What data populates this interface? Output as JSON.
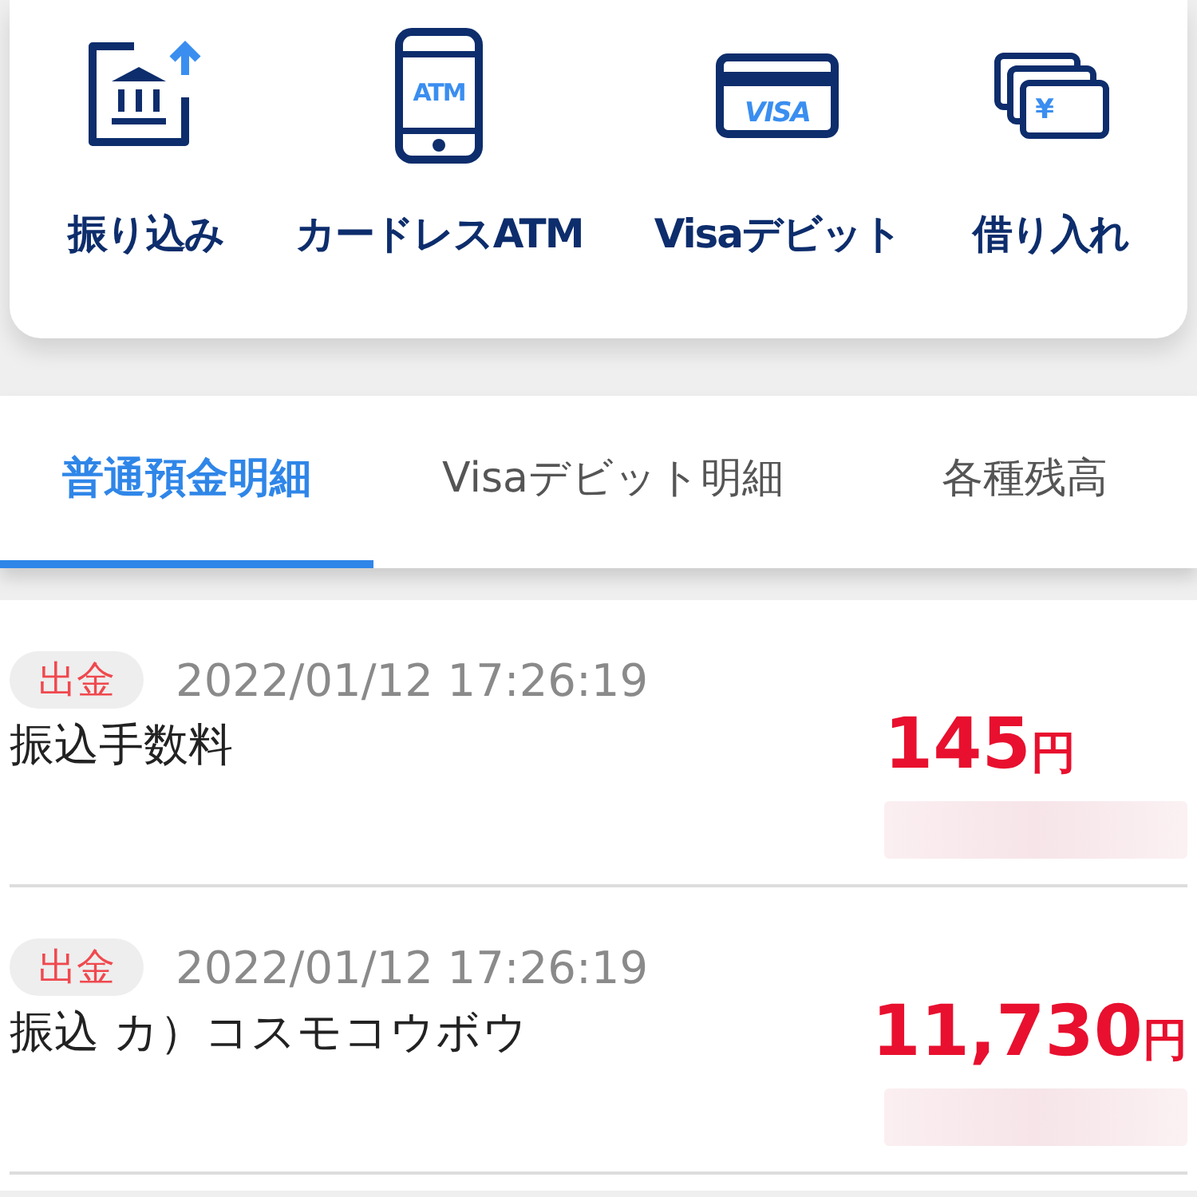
{
  "actions": [
    {
      "kind": "transfer",
      "label": "振り込み"
    },
    {
      "kind": "atm",
      "label": "カードレスATM",
      "icon_text": "ATM"
    },
    {
      "kind": "card",
      "label": "Visaデビット",
      "icon_text": "VISA"
    },
    {
      "kind": "loan",
      "label": "借り入れ",
      "icon_text": "¥"
    }
  ],
  "tabs": [
    {
      "label": "普通預金明細",
      "selected": true
    },
    {
      "label": "Visaデビット明細",
      "selected": false
    },
    {
      "label": "各種残高",
      "selected": false
    }
  ],
  "transactions": [
    {
      "type": "出金",
      "datetime": "2022/01/12 17:26:19",
      "description": "振込手数料",
      "amount": "145",
      "unit": "円"
    },
    {
      "type": "出金",
      "datetime": "2022/01/12 17:26:19",
      "description": "振込 カ）コスモコウボウ",
      "amount": "11,730",
      "unit": "円"
    }
  ]
}
